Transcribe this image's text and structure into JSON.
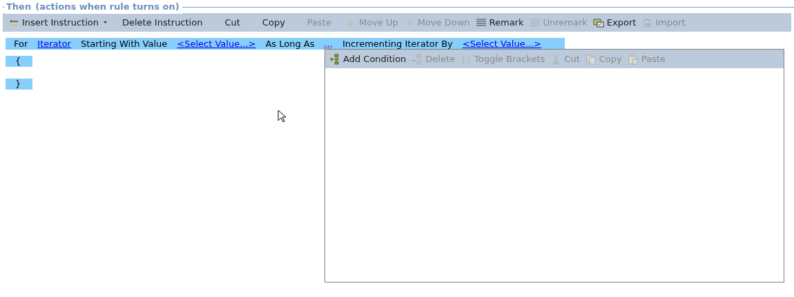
{
  "section": {
    "legend": "Then",
    "subtitle": "(actions when rule turns on)"
  },
  "toolbar": [
    {
      "label": "Insert Instruction",
      "disabled": false,
      "dropdown": true
    },
    {
      "label": "Delete Instruction",
      "disabled": false,
      "dropdown": false
    },
    {
      "label": "Cut",
      "disabled": false,
      "dropdown": false
    },
    {
      "label": "Copy",
      "disabled": false,
      "dropdown": false
    },
    {
      "label": "Paste",
      "disabled": true,
      "dropdown": false
    },
    {
      "label": "Move Up",
      "disabled": true,
      "dropdown": false
    },
    {
      "label": "Move Down",
      "disabled": true,
      "dropdown": false
    },
    {
      "label": "Remark",
      "disabled": false,
      "dropdown": false
    },
    {
      "label": "Unremark",
      "disabled": true,
      "dropdown": false
    },
    {
      "label": "Export",
      "disabled": false,
      "dropdown": false
    },
    {
      "label": "Import",
      "disabled": true,
      "dropdown": false
    }
  ],
  "statement": [
    {
      "kind": "text",
      "text": "For"
    },
    {
      "kind": "link",
      "text": "Iterator"
    },
    {
      "kind": "text",
      "text": "Starting With Value"
    },
    {
      "kind": "link",
      "text": "<Select Value...>"
    },
    {
      "kind": "text",
      "text": "As Long As"
    },
    {
      "kind": "empty",
      "text": "..."
    },
    {
      "kind": "text",
      "text": "Incrementing Iterator By"
    },
    {
      "kind": "link",
      "text": "<Select Value...>"
    }
  ],
  "braces": [
    "{",
    "}"
  ],
  "condition_panel": {
    "toolbar": [
      {
        "label": "Add Condition",
        "disabled": false
      },
      {
        "label": "Delete",
        "disabled": true
      },
      {
        "label": "Toggle Brackets",
        "disabled": true
      },
      {
        "label": "Cut",
        "disabled": true
      },
      {
        "label": "Copy",
        "disabled": true
      },
      {
        "label": "Paste",
        "disabled": true
      }
    ]
  }
}
